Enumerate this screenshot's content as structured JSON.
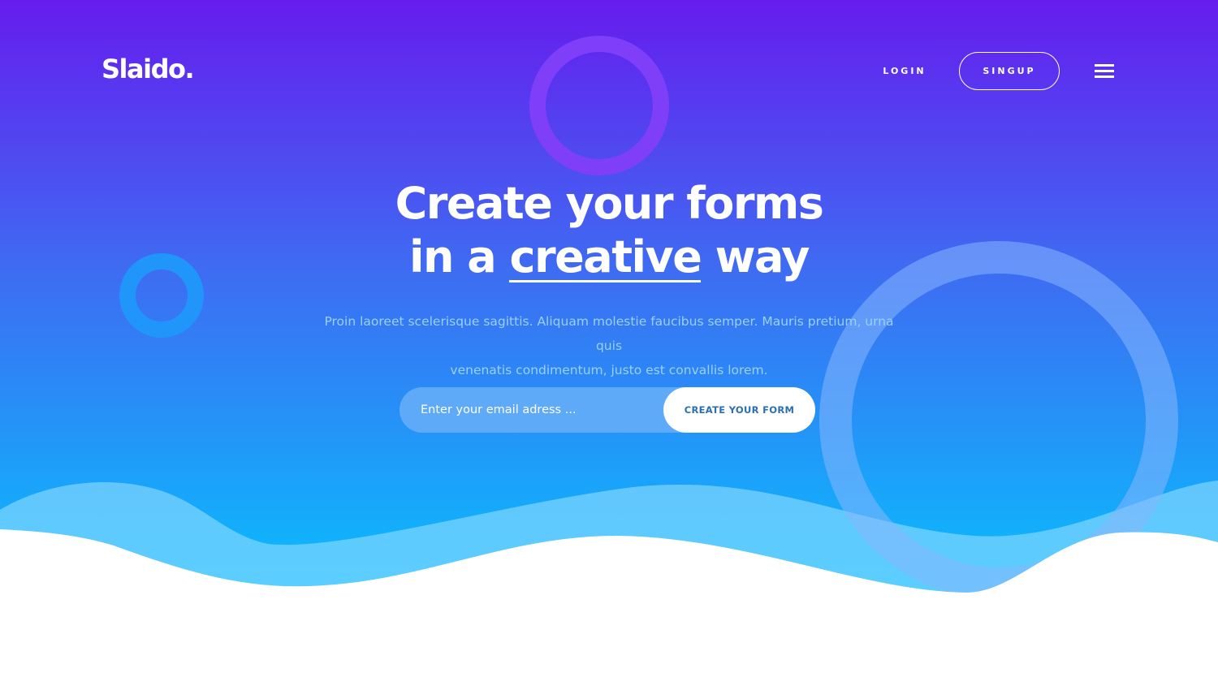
{
  "header": {
    "logo": "Slaido.",
    "login_label": "LOGIN",
    "signup_label": "SINGUP"
  },
  "hero": {
    "headline_line1": "Create your forms",
    "headline_line2_prefix": "in a ",
    "headline_line2_emphasis": "creative",
    "headline_line2_suffix": " way",
    "subtitle_line1": "Proin laoreet scelerisque sagittis. Aliquam molestie faucibus semper. Mauris pretium, urna quis",
    "subtitle_line2": "venenatis condimentum, justo est convallis lorem."
  },
  "form": {
    "email_placeholder": "Enter your email adress ...",
    "email_value": "",
    "submit_label": "CREATE YOUR FORM"
  },
  "icons": {
    "menu": "hamburger-menu-icon"
  },
  "colors": {
    "gradient_top": "#661cee",
    "gradient_mid": "#3f6af2",
    "gradient_bottom": "#0abcfd",
    "wave_light": "#5dcefd",
    "input_bg": "#5eaaf9",
    "button_text": "#2b6fb3",
    "subtitle_text": "#9ad0f5"
  }
}
